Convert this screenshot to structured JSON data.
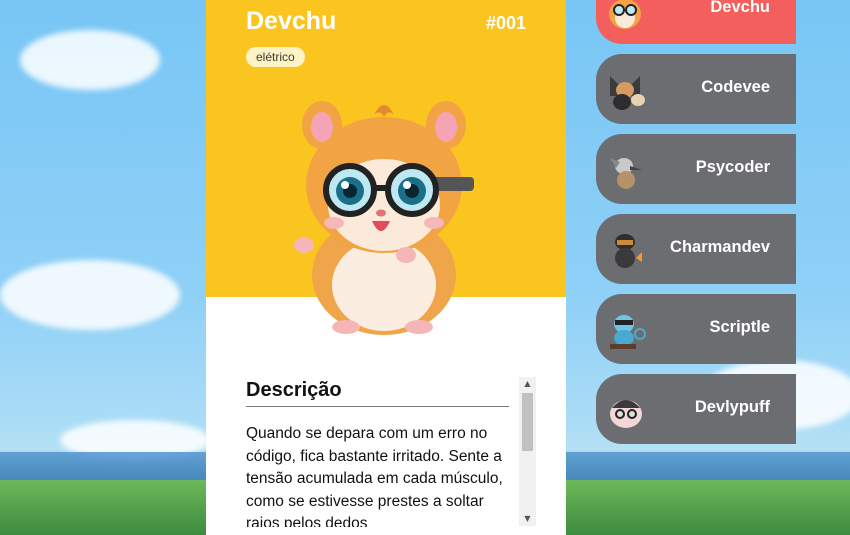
{
  "detail": {
    "name": "Devchu",
    "number": "#001",
    "type": "elétrico",
    "description_title": "Descrição",
    "description": "Quando se depara com um erro no código, fica bastante irritado. Sente a tensão acumulada em cada músculo, como se estivesse prestes a soltar raios pelos dedos"
  },
  "colors": {
    "card_header": "#fbc51f",
    "active_item": "#f25f5c",
    "inactive_item": "#6b6d71"
  },
  "list": [
    {
      "label": "Devchu",
      "active": true
    },
    {
      "label": "Codevee",
      "active": false
    },
    {
      "label": "Psycoder",
      "active": false
    },
    {
      "label": "Charmandev",
      "active": false
    },
    {
      "label": "Scriptle",
      "active": false
    },
    {
      "label": "Devlypuff",
      "active": false
    }
  ]
}
